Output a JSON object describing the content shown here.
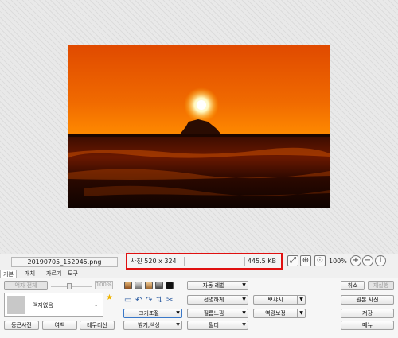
{
  "status": {
    "filename": "20190705_152945.png",
    "dimensions": "사진 520 x 324",
    "filesize": "445.5 KB",
    "zoom": "100%"
  },
  "tabs": [
    "기본",
    "개체",
    "자르기",
    "도구"
  ],
  "left": {
    "frame_all_label": "액자 전체",
    "percent": "100%",
    "frame_select_value": "액자없음",
    "rounded_label": "둥근사진",
    "margin_label": "여백",
    "border_label": "테두리선"
  },
  "middle": {
    "resize_label": "크기조절",
    "brightness_label": "밝기,색상",
    "auto_level_label": "자동 레벨",
    "sharpen_label": "선명하게",
    "film_label": "필름느낌",
    "filter_label": "필터",
    "blur_label": "뽀샤시",
    "backlight_label": "역광보정"
  },
  "right": {
    "cancel_label": "취소",
    "redo_label": "재실행",
    "original_label": "원본 사진",
    "save_label": "저장",
    "menu_label": "메뉴"
  }
}
